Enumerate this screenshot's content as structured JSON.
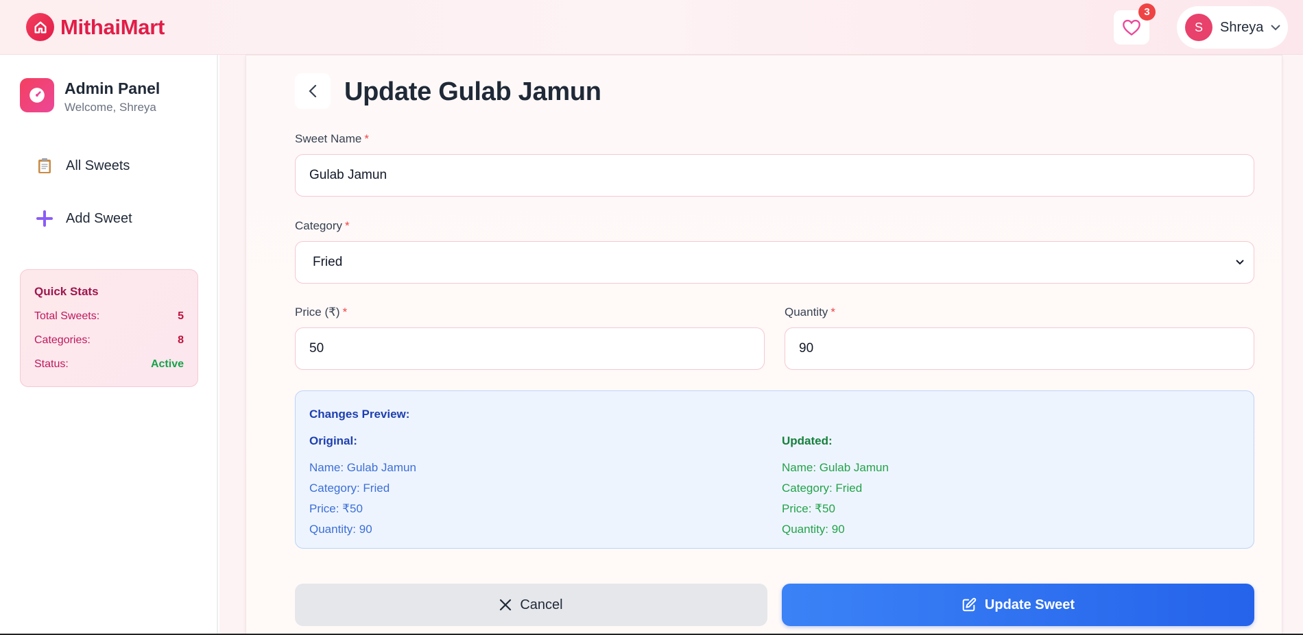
{
  "brand": {
    "name": "MithaiMart"
  },
  "header": {
    "wishlist_count": "3",
    "user": {
      "initial": "S",
      "name": "Shreya"
    }
  },
  "sidebar": {
    "title": "Admin Panel",
    "welcome": "Welcome, Shreya",
    "items": [
      {
        "label": "All Sweets",
        "icon": "clipboard-icon"
      },
      {
        "label": "Add Sweet",
        "icon": "plus-icon"
      }
    ],
    "stats": {
      "title": "Quick Stats",
      "rows": [
        {
          "label": "Total Sweets:",
          "value": "5"
        },
        {
          "label": "Categories:",
          "value": "8"
        },
        {
          "label": "Status:",
          "value": "Active"
        }
      ]
    }
  },
  "form": {
    "title": "Update Gulab Jamun",
    "required_mark": "*",
    "name_label": "Sweet Name",
    "name_value": "Gulab Jamun",
    "category_label": "Category",
    "category_value": "Fried",
    "price_label": "Price (₹)",
    "price_value": "50",
    "quantity_label": "Quantity",
    "quantity_value": "90"
  },
  "preview": {
    "title": "Changes Preview:",
    "original": {
      "head": "Original:",
      "lines": [
        "Name: Gulab Jamun",
        "Category: Fried",
        "Price: ₹50",
        "Quantity: 90"
      ]
    },
    "updated": {
      "head": "Updated:",
      "lines": [
        "Name: Gulab Jamun",
        "Category: Fried",
        "Price: ₹50",
        "Quantity: 90"
      ]
    }
  },
  "actions": {
    "cancel_label": "Cancel",
    "update_label": "Update Sweet"
  },
  "colors": {
    "brand": "#e11d48",
    "primary": "#2563eb",
    "success": "#16a34a"
  }
}
